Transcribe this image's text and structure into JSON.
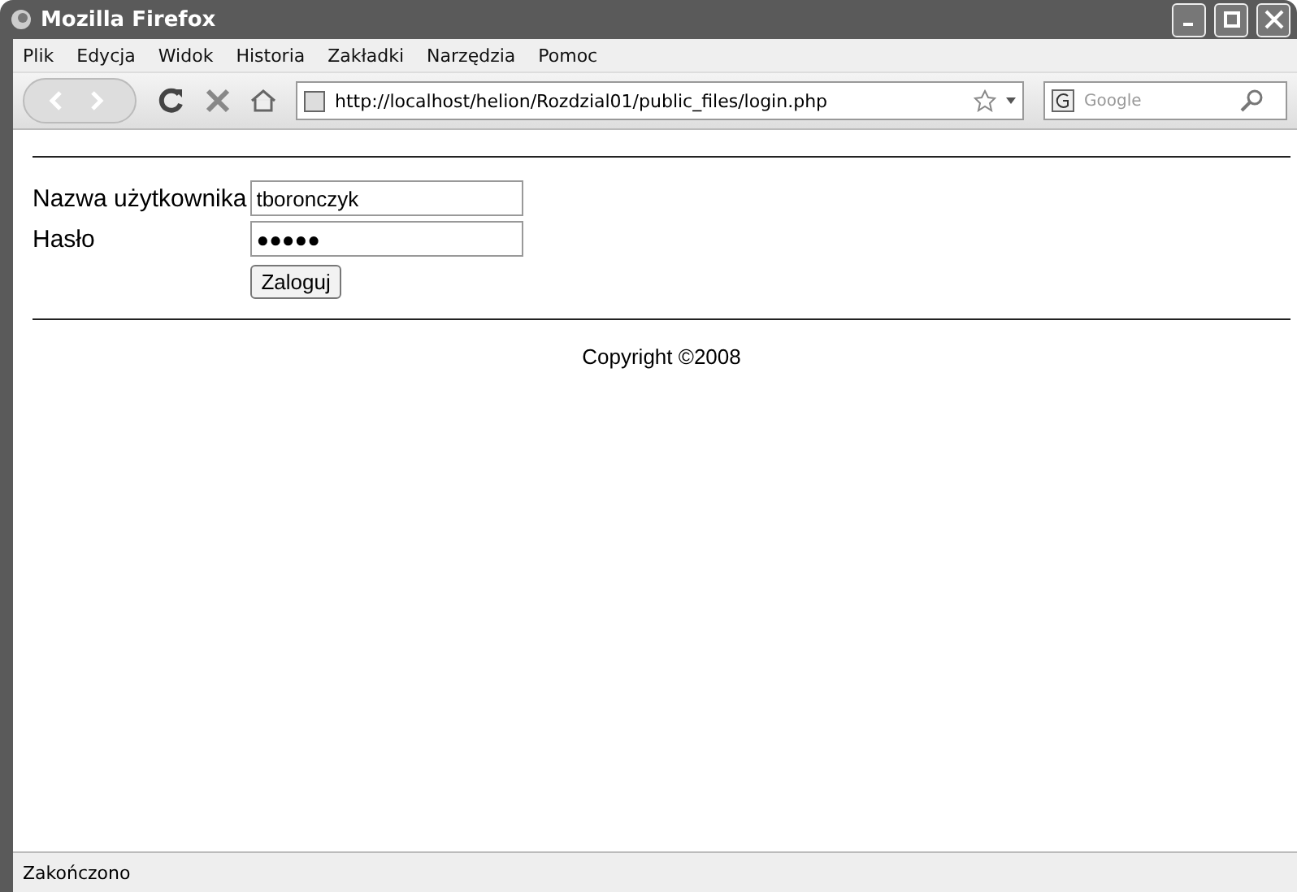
{
  "window": {
    "title": "Mozilla Firefox"
  },
  "menu": [
    "Plik",
    "Edycja",
    "Widok",
    "Historia",
    "Zakładki",
    "Narzędzia",
    "Pomoc"
  ],
  "toolbar": {
    "url": "http://localhost/helion/Rozdzial01/public_files/login.php",
    "search": {
      "placeholder": "Google"
    }
  },
  "form": {
    "fields": [
      {
        "label": "Nazwa użytkownika",
        "value": "tboronczyk"
      },
      {
        "label": "Hasło",
        "value": "●●●●●"
      }
    ],
    "submit": "Zaloguj"
  },
  "footer": "Copyright ©2008",
  "status_bar": "Zakończono"
}
